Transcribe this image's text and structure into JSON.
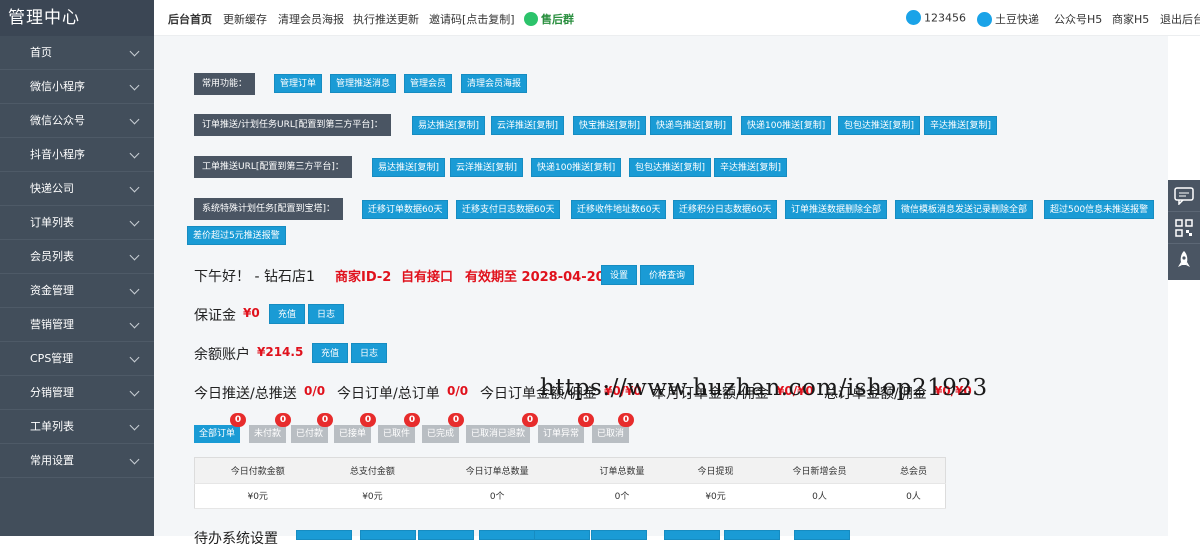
{
  "sidebar": {
    "title": "管理中心",
    "items": [
      {
        "label": "首页"
      },
      {
        "label": "微信小程序"
      },
      {
        "label": "微信公众号"
      },
      {
        "label": "抖音小程序"
      },
      {
        "label": "快递公司"
      },
      {
        "label": "订单列表"
      },
      {
        "label": "会员列表"
      },
      {
        "label": "资金管理"
      },
      {
        "label": "营销管理"
      },
      {
        "label": "CPS管理"
      },
      {
        "label": "分销管理"
      },
      {
        "label": "工单列表"
      },
      {
        "label": "常用设置"
      }
    ]
  },
  "topbar": {
    "links": [
      "后台首页",
      "更新缓存",
      "清理会员海报",
      "执行推送更新",
      "邀请码[点击复制]",
      "售后群"
    ],
    "qq": "123456",
    "right_links": [
      "土豆快递",
      "公众号H5",
      "商家H5",
      "退出后台"
    ]
  },
  "common": {
    "label": "常用功能：",
    "buttons": [
      "管理订单",
      "管理推送消息",
      "管理会员",
      "清理会员海报"
    ]
  },
  "order_push": {
    "label": "订单推送/计划任务URL[配置到第三方平台]：",
    "buttons": [
      "易达推送[复制]",
      "云洋推送[复制]",
      "快宝推送[复制]",
      "快递鸟推送[复制]",
      "快递100推送[复制]",
      "包包达推送[复制]",
      "辛达推送[复制]"
    ]
  },
  "ticket_push": {
    "label": "工单推送URL[配置到第三方平台]：",
    "buttons": [
      "易达推送[复制]",
      "云洋推送[复制]",
      "快递100推送[复制]",
      "包包达推送[复制]",
      "辛达推送[复制]"
    ]
  },
  "system_tasks": {
    "label": "系统特殊计划任务[配置到宝塔]：",
    "buttons": [
      "迁移订单数据60天",
      "迁移支付日志数据60天",
      "迁移收件地址数60天",
      "迁移积分日志数据60天",
      "订单推送数据删除全部",
      "微信模板消息发送记录删除全部",
      "超过500信息未推送报警",
      "差价超过5元推送报警"
    ]
  },
  "greeting": {
    "text": "下午好！ - 钻石店1",
    "merchant_id": "商家ID-2",
    "interface": "自有接口",
    "valid_until": "有效期至 2028-04-20",
    "buttons": [
      "设置",
      "价格查询"
    ]
  },
  "deposit": {
    "label": "保证金",
    "value": "¥0",
    "buttons": [
      "充值",
      "日志"
    ]
  },
  "balance": {
    "label": "余额账户",
    "value": "¥214.5",
    "buttons": [
      "充值",
      "日志"
    ]
  },
  "summary": [
    {
      "label": "今日推送/总推送",
      "value": "0/0"
    },
    {
      "label": "今日订单/总订单",
      "value": "0/0"
    },
    {
      "label": "今日订单金额/佣金",
      "value": "¥0/¥0"
    },
    {
      "label": "本月订单金额/佣金",
      "value": "¥0/¥0"
    },
    {
      "label": "总订单金额/佣金",
      "value": "¥0/¥0"
    }
  ],
  "status_tabs": [
    {
      "label": "全部订单",
      "count": "0"
    },
    {
      "label": "未付款",
      "count": "0"
    },
    {
      "label": "已付款",
      "count": "0"
    },
    {
      "label": "已接单",
      "count": "0"
    },
    {
      "label": "已取件",
      "count": "0"
    },
    {
      "label": "已完成",
      "count": "0"
    },
    {
      "label": "已取消已退款",
      "count": "0"
    },
    {
      "label": "订单异常",
      "count": "0"
    },
    {
      "label": "已取消",
      "count": "0"
    }
  ],
  "stats": {
    "headers": [
      "今日付款金额",
      "总支付金额",
      "今日订单总数量",
      "订单总数量",
      "今日提现",
      "今日新增会员",
      "总会员"
    ],
    "values": [
      "¥0元",
      "¥0元",
      "0个",
      "0个",
      "¥0元",
      "0人",
      "0人"
    ]
  },
  "bottom_label": "待办系统设置",
  "watermark": "https://www.huzhan.com/ishop21923",
  "colors": {
    "sidebar": "#424e5b",
    "button": "#1a9bd5",
    "label": "#4a5563",
    "red": "#e0111c",
    "badge": "#e72c2c"
  }
}
